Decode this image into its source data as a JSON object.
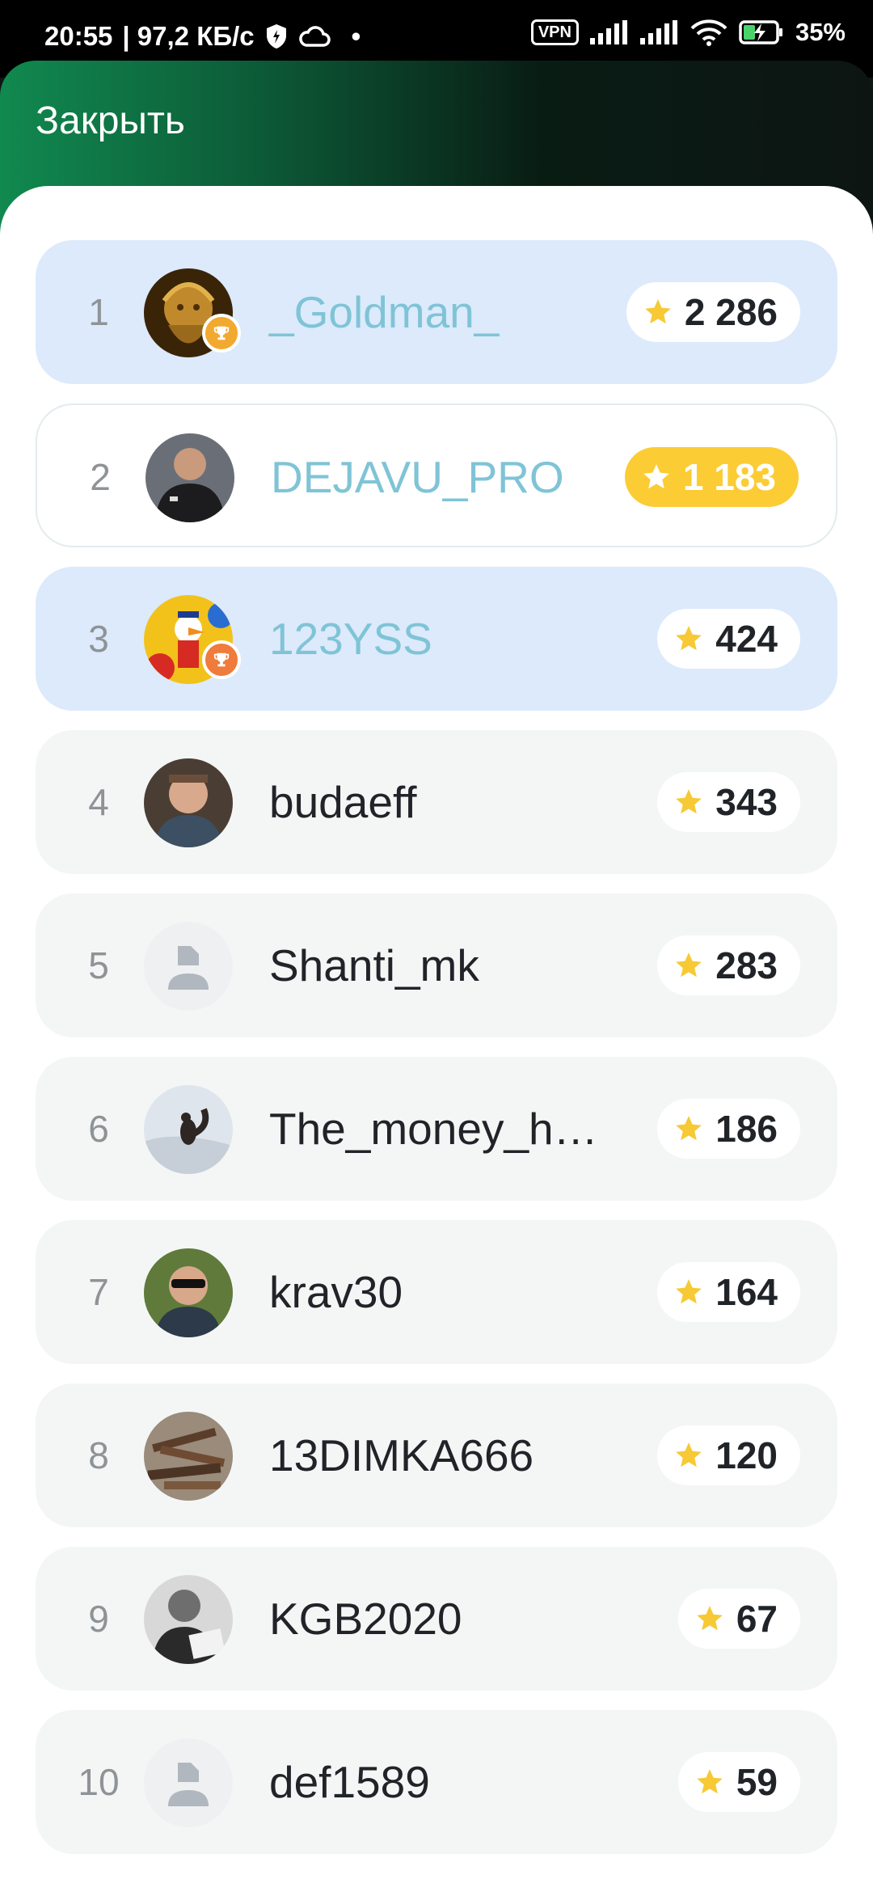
{
  "status_bar": {
    "time": "20:55",
    "speed": "| 97,2 КБ/с",
    "vpn": "VPN",
    "battery": "35%",
    "dot": "•"
  },
  "header": {
    "close_label": "Закрыть"
  },
  "leaderboard": [
    {
      "rank": "1",
      "name": "_Goldman_",
      "score": "2 286",
      "accent": true,
      "style": "highlight",
      "trophy": "#f2a92f",
      "avatar": "golden-statue"
    },
    {
      "rank": "2",
      "name": "DEJAVU_PRO",
      "score": "1 183",
      "accent": true,
      "style": "outline",
      "gold_score": true,
      "avatar": "man-in-black-shirt"
    },
    {
      "rank": "3",
      "name": "123YSS",
      "score": "424",
      "accent": true,
      "style": "highlight",
      "trophy": "#ef7b3c",
      "avatar": "cartoon-duck"
    },
    {
      "rank": "4",
      "name": "budaeff",
      "score": "343",
      "accent": false,
      "style": "plain",
      "avatar": "man-portrait"
    },
    {
      "rank": "5",
      "name": "Shanti_mk",
      "score": "283",
      "accent": false,
      "style": "plain",
      "avatar": "default-user"
    },
    {
      "rank": "6",
      "name": "The_money_h…",
      "score": "186",
      "accent": false,
      "style": "plain",
      "avatar": "squirrel-in-snow"
    },
    {
      "rank": "7",
      "name": "krav30",
      "score": "164",
      "accent": false,
      "style": "plain",
      "avatar": "man-with-sunglasses"
    },
    {
      "rank": "8",
      "name": "13DIMKA666",
      "score": "120",
      "accent": false,
      "style": "plain",
      "avatar": "pile-of-wood"
    },
    {
      "rank": "9",
      "name": "KGB2020",
      "score": "67",
      "accent": false,
      "style": "plain",
      "avatar": "bw-portrait"
    },
    {
      "rank": "10",
      "name": "def1589",
      "score": "59",
      "accent": false,
      "style": "plain",
      "avatar": "default-user"
    }
  ],
  "colors": {
    "accent_name": "#7fc4d6",
    "highlight_row": "#dceafb",
    "gold_badge": "#fccc35",
    "star": "#f6c935",
    "header_green": "#11894f"
  }
}
